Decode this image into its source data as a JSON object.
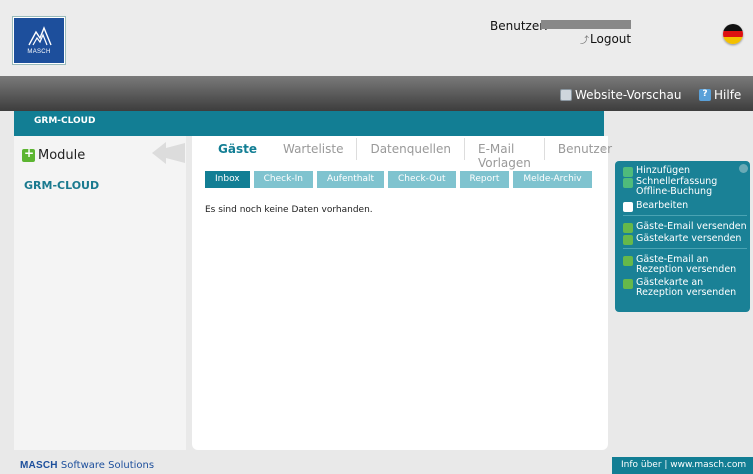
{
  "header": {
    "logo_text": "MASCH",
    "user_label": "Benutzer:",
    "logout_label": "Logout"
  },
  "topbar": {
    "preview_label": "Website-Vorschau",
    "help_label": "Hilfe"
  },
  "breadcrumb": {
    "label": "GRM-CLOUD"
  },
  "sidebar": {
    "title": "Module",
    "items": [
      {
        "label": "GRM-CLOUD"
      }
    ]
  },
  "main": {
    "tabs": [
      {
        "label": "Gäste",
        "active": true
      },
      {
        "label": "Warteliste"
      },
      {
        "label": "Datenquellen"
      },
      {
        "label": "E-Mail Vorlagen"
      },
      {
        "label": "Benutzer"
      }
    ],
    "subtabs": [
      {
        "label": "Inbox",
        "active": true
      },
      {
        "label": "Check-In"
      },
      {
        "label": "Aufenthalt"
      },
      {
        "label": "Check-Out"
      },
      {
        "label": "Report"
      },
      {
        "label": "Melde-Archiv"
      }
    ],
    "empty_message": "Es sind noch keine Daten vorhanden."
  },
  "actions": {
    "add": "Hinzufügen",
    "quick_entry_1": "Schnellerfassung",
    "quick_entry_2": "Offline-Buchung",
    "edit": "Bearbeiten",
    "guest_email": "Gäste-Email versenden",
    "guest_card": "Gästekarte versenden",
    "guest_email_reception_1": "Gäste-Email an",
    "guest_email_reception_2": "Rezeption versenden",
    "guest_card_reception_1": "Gästekarte an",
    "guest_card_reception_2": "Rezeption versenden"
  },
  "footer": {
    "brand_bold": "MASCH",
    "brand_rest": "Software Solutions",
    "info": "Info über | www.masch.com"
  },
  "colors": {
    "teal": "#127e94",
    "teal_light": "#7fc3cf",
    "logo_blue": "#1d4f9c"
  }
}
